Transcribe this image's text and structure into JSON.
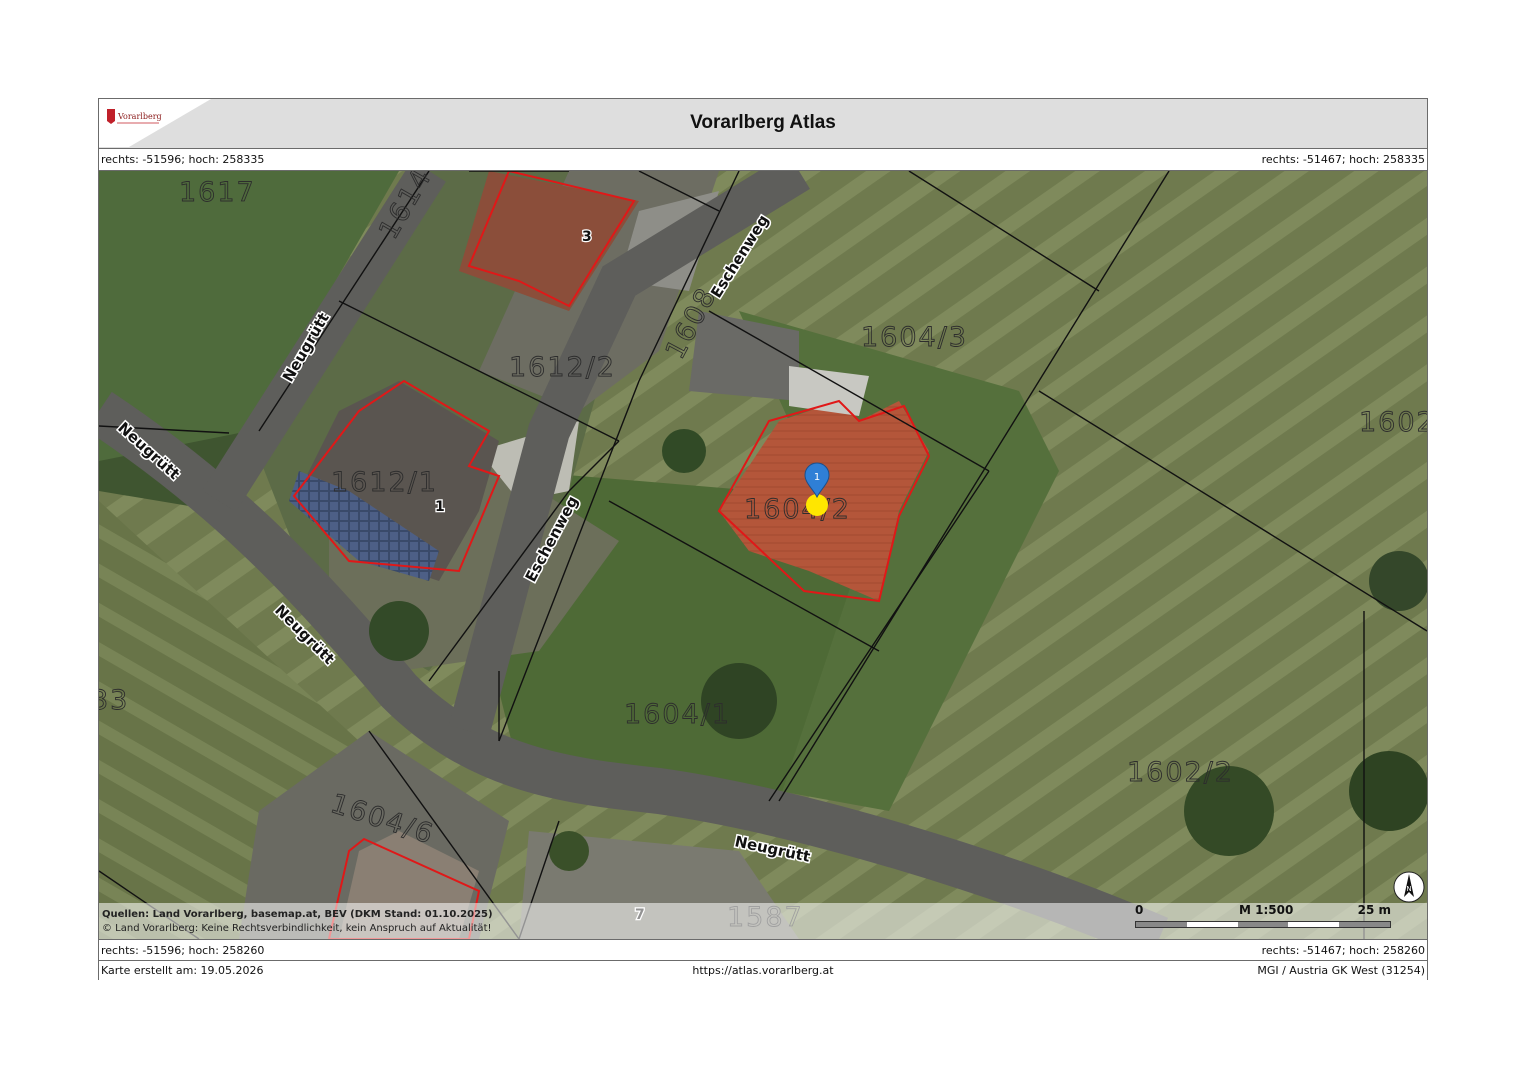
{
  "header": {
    "title": "Vorarlberg Atlas",
    "logo_text": "Vorarlberg"
  },
  "coords": {
    "top_left": "rechts: -51596; hoch: 258335",
    "top_right": "rechts: -51467; hoch: 258335",
    "bottom_left": "rechts: -51596; hoch: 258260",
    "bottom_right": "rechts: -51467; hoch: 258260"
  },
  "map": {
    "parcels": [
      "1617",
      "1614",
      "1612/2",
      "1608",
      "1604/3",
      "1602",
      "1612/1",
      "1604/2",
      "1604/1",
      "1604/6",
      "1602/2",
      "33",
      "1587"
    ],
    "streets": [
      "Neugrütt",
      "Neugrütt",
      "Neugrütt",
      "Neugrütt",
      "Eschenweg",
      "Eschenweg"
    ],
    "house_numbers": [
      "3",
      "1",
      "7"
    ],
    "marker_label": "1",
    "colors": {
      "parcel_outline": "#111111",
      "building_outline": "#e01818",
      "road": "#5e5e5b",
      "marker": "#2f7fd6",
      "highlight": "#ffe600"
    }
  },
  "attribution": {
    "sources": "Quellen: Land Vorarlberg, basemap.at, BEV (DKM Stand: 01.10.2025)",
    "disclaimer": "© Land Vorarlberg: Keine Rechtsverbindlichkeit, kein Anspruch auf Aktualität!"
  },
  "scale": {
    "start": "0",
    "ratio": "M 1:500",
    "end": "25 m"
  },
  "north_label": "N",
  "footer": {
    "created": "Karte erstellt am: 19.05.2026",
    "url": "https://atlas.vorarlberg.at",
    "crs": "MGI / Austria GK West (31254)"
  }
}
